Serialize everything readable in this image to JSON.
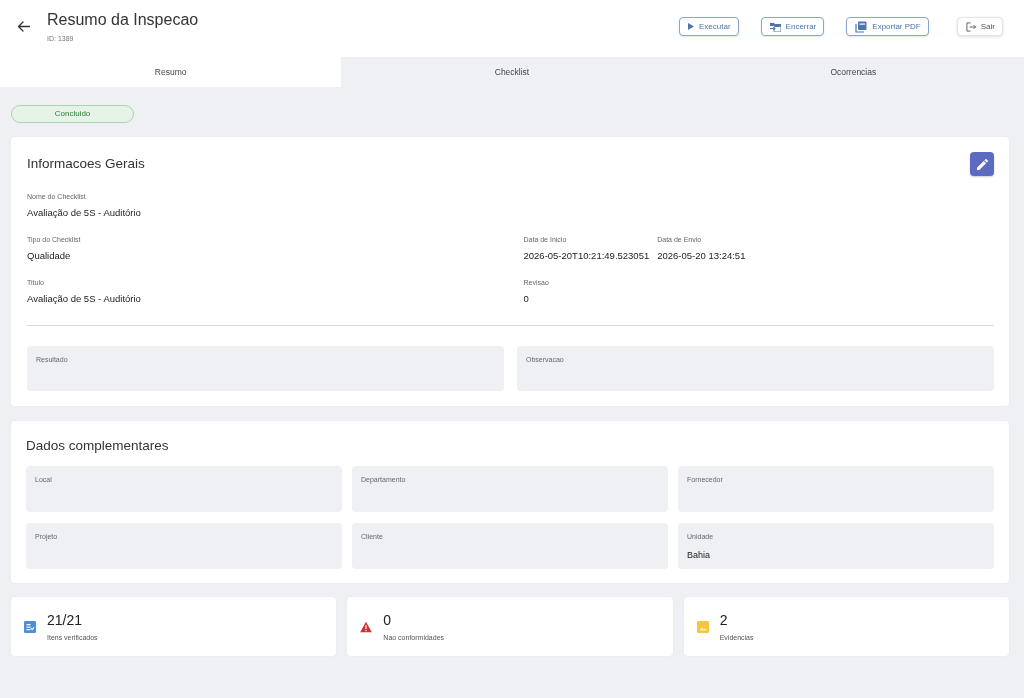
{
  "header": {
    "title": "Resumo da Inspecao",
    "subtitle": "ID: 1389",
    "actions": [
      {
        "label": "Executar",
        "kind": "execute"
      },
      {
        "label": "Encerrar",
        "kind": "close"
      },
      {
        "label": "Exportar PDF",
        "kind": "export"
      },
      {
        "label": "Sair",
        "kind": "exit"
      }
    ]
  },
  "tabs": [
    {
      "label": "Resumo",
      "selected": true
    },
    {
      "label": "Checklist",
      "selected": false
    },
    {
      "label": "Ocorrencias",
      "selected": false
    }
  ],
  "status_badge": "Concluido",
  "general_info": {
    "title": "Informacoes Gerais",
    "rows": [
      {
        "groups": [
          {
            "fields": [
              {
                "label": "Nome do Checklist",
                "value": "Avaliação de 5S - Auditório"
              }
            ]
          }
        ]
      },
      {
        "groups": [
          {
            "fields": [
              {
                "label": "Tipo do Checklist",
                "value": "Qualidade"
              }
            ]
          },
          {
            "fields": [
              {
                "label": "Data de Inicio",
                "value": "2026-05-20T10:21:49.523051"
              },
              {
                "label": "Data de Envio",
                "value": "2026-05-20 13:24:51"
              }
            ]
          }
        ]
      },
      {
        "groups": [
          {
            "fields": [
              {
                "label": "Titulo",
                "value": "Avaliação de 5S - Auditório"
              }
            ]
          },
          {
            "fields": [
              {
                "label": "Revisao",
                "value": "0"
              }
            ]
          }
        ]
      }
    ],
    "notes": [
      {
        "label": "Resultado"
      },
      {
        "label": "Observacao"
      }
    ]
  },
  "complementary": {
    "title": "Dados complementares",
    "fields": [
      {
        "label": "Local"
      },
      {
        "label": "Departamento"
      },
      {
        "label": "Fornecedor"
      },
      {
        "label": "Projeto"
      },
      {
        "label": "Cliente"
      },
      {
        "label": "Unidade",
        "value": "Bahia"
      }
    ]
  },
  "stats": [
    {
      "kind": "checked",
      "value": "21/21",
      "label": "Itens verificados"
    },
    {
      "kind": "issues",
      "value": "0",
      "label": "Nao conformidades"
    },
    {
      "kind": "evidence",
      "value": "2",
      "label": "Evidencias"
    }
  ]
}
